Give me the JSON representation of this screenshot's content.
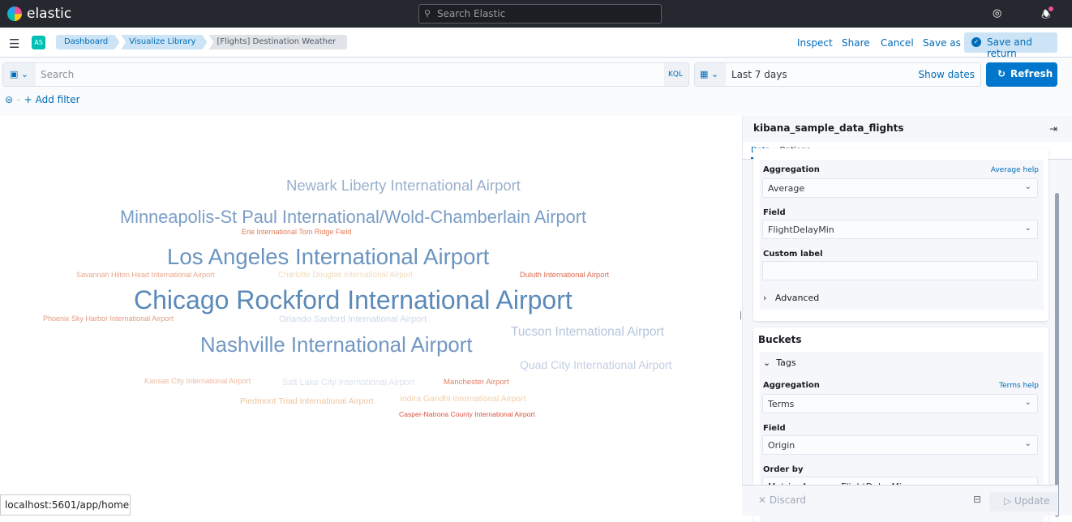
{
  "header": {
    "brand": "elastic",
    "search_placeholder": "Search Elastic",
    "avatar": "AS"
  },
  "breadcrumbs": [
    "Dashboard",
    "Visualize Library",
    "[Flights] Destination Weather"
  ],
  "toolbar": {
    "inspect": "Inspect",
    "share": "Share",
    "cancel": "Cancel",
    "save_as": "Save as",
    "save_return": "Save and return"
  },
  "query": {
    "placeholder": "Search",
    "language": "KQL",
    "date": "Last 7 days",
    "show_dates": "Show dates",
    "refresh": "Refresh",
    "add_filter": "+ Add filter"
  },
  "chart_data": {
    "type": "wordcloud",
    "words": [
      {
        "text": "Newark Liberty International Airport",
        "color": "#9ab0cc"
      },
      {
        "text": "Minneapolis-St Paul International/Wold-Chamberlain Airport",
        "color": "#7a9ec6"
      },
      {
        "text": "Erie International Tom Ridge Field",
        "color": "#e07b5a"
      },
      {
        "text": "Los Angeles International Airport",
        "color": "#6a94c0"
      },
      {
        "text": "Savannah Hilton Head International Airport",
        "color": "#e8a88a"
      },
      {
        "text": "Charlotte Douglas International Airport",
        "color": "#f0dcbc"
      },
      {
        "text": "Duluth International Airport",
        "color": "#dc6a50"
      },
      {
        "text": "Chicago Rockford International Airport",
        "color": "#5b8ab9"
      },
      {
        "text": "Phoenix Sky Harbor International Airport",
        "color": "#e49a80"
      },
      {
        "text": "Orlando Sanford International Airport",
        "color": "#cdd8e8"
      },
      {
        "text": "Tucson International Airport",
        "color": "#b4c5dc"
      },
      {
        "text": "Nashville International Airport",
        "color": "#7397c3"
      },
      {
        "text": "Quad City International Airport",
        "color": "#c1cfe2"
      },
      {
        "text": "Kansas City International Airport",
        "color": "#ecb8a0"
      },
      {
        "text": "Salt Lake City International Airport",
        "color": "#dbe2ee"
      },
      {
        "text": "Manchester Airport",
        "color": "#df7f63"
      },
      {
        "text": "Piedmont Triad International Airport",
        "color": "#edc4a0"
      },
      {
        "text": "Indira Gandhi International Airport",
        "color": "#f1cfa8"
      },
      {
        "text": "Casper-Natrona County International Airport",
        "color": "#d9523f"
      }
    ]
  },
  "panel": {
    "index": "kibana_sample_data_flights",
    "tabs": [
      "Data",
      "Options"
    ],
    "metric": {
      "agg_label": "Aggregation",
      "agg_help": "Average help",
      "agg_value": "Average",
      "field_label": "Field",
      "field_value": "FlightDelayMin",
      "custom_label": "Custom label",
      "advanced": "Advanced"
    },
    "buckets": {
      "title": "Buckets",
      "tags": "Tags",
      "agg_label": "Aggregation",
      "agg_help": "Terms help",
      "agg_value": "Terms",
      "field_label": "Field",
      "field_value": "Origin",
      "order_label": "Order by",
      "order_value": "Metric: Average FlightDelayMin"
    },
    "discard": "Discard",
    "update": "Update"
  },
  "status_url": "localhost:5601/app/home"
}
